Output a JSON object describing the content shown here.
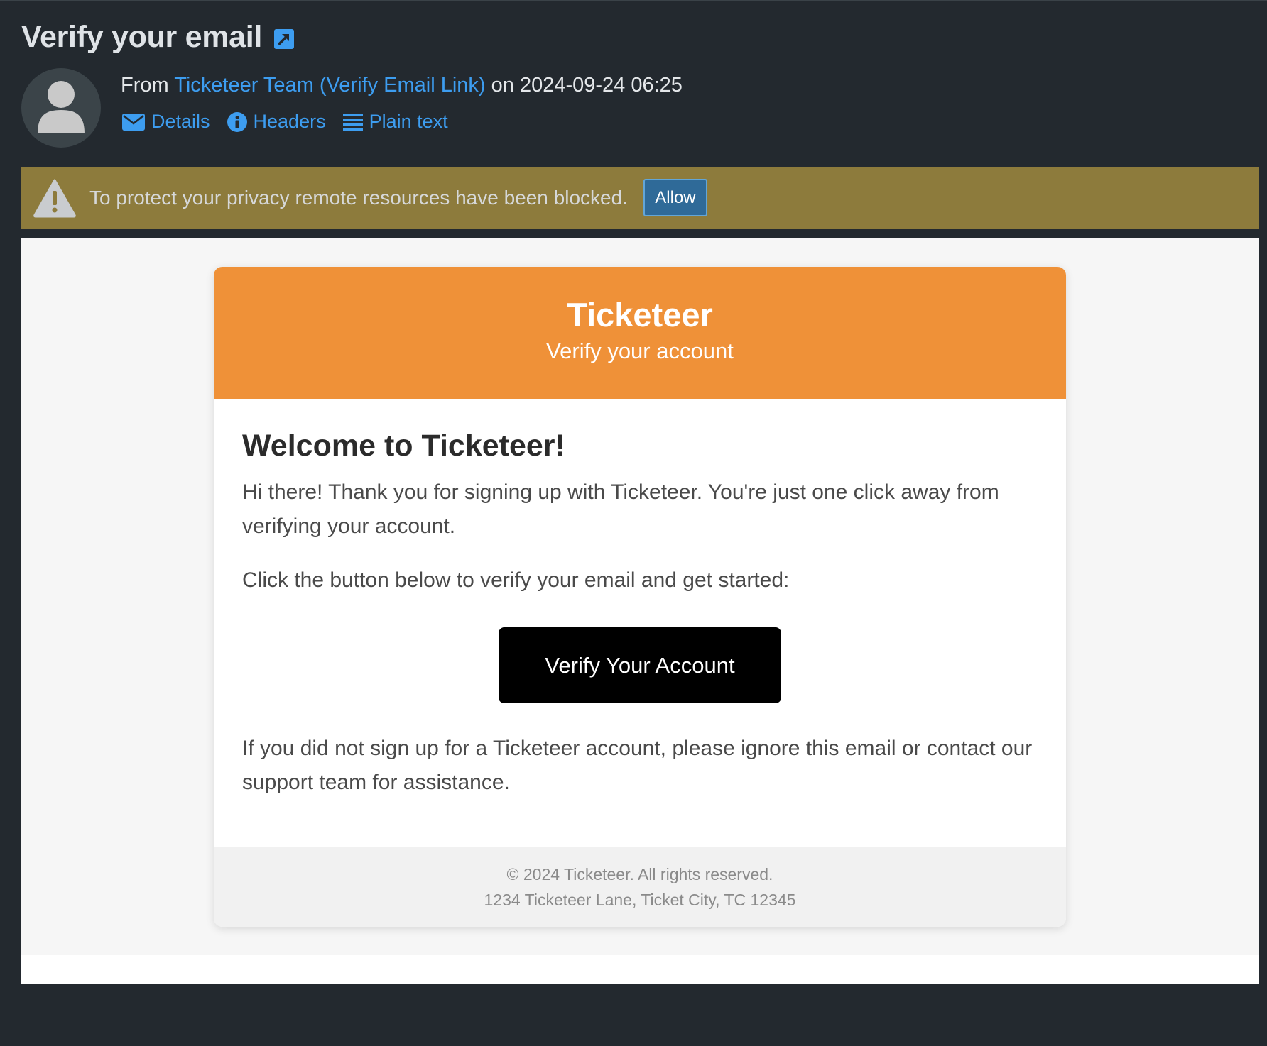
{
  "message": {
    "subject": "Verify your email",
    "from_prefix": "From",
    "sender": "Ticketeer Team (Verify Email Link)",
    "date_prefix": "on",
    "date": "2024-09-24 06:25"
  },
  "actions": [
    {
      "label": "Details",
      "icon": "envelope-icon"
    },
    {
      "label": "Headers",
      "icon": "info-icon"
    },
    {
      "label": "Plain text",
      "icon": "lines-icon"
    }
  ],
  "privacy": {
    "text": "To protect your privacy remote resources have been blocked.",
    "allow_label": "Allow"
  },
  "email": {
    "brand": "Ticketeer",
    "tagline": "Verify your account",
    "heading": "Welcome to Ticketeer!",
    "intro": "Hi there! Thank you for signing up with Ticketeer. You're just one click away from verifying your account.",
    "instruction": "Click the button below to verify your email and get started:",
    "cta_label": "Verify Your Account",
    "disclaimer": "If you did not sign up for a Ticketeer account, please ignore this email or contact our support team for assistance.",
    "footer_copyright": "© 2024 Ticketeer. All rights reserved.",
    "footer_address": "1234 Ticketeer Lane, Ticket City, TC 12345"
  },
  "colors": {
    "page_background": "#23292f",
    "link": "#3d9df0",
    "privacy_banner": "#8d7b3c",
    "allow_button": "#2f6a98",
    "email_header": "#ef9138",
    "cta_button": "#000000"
  }
}
